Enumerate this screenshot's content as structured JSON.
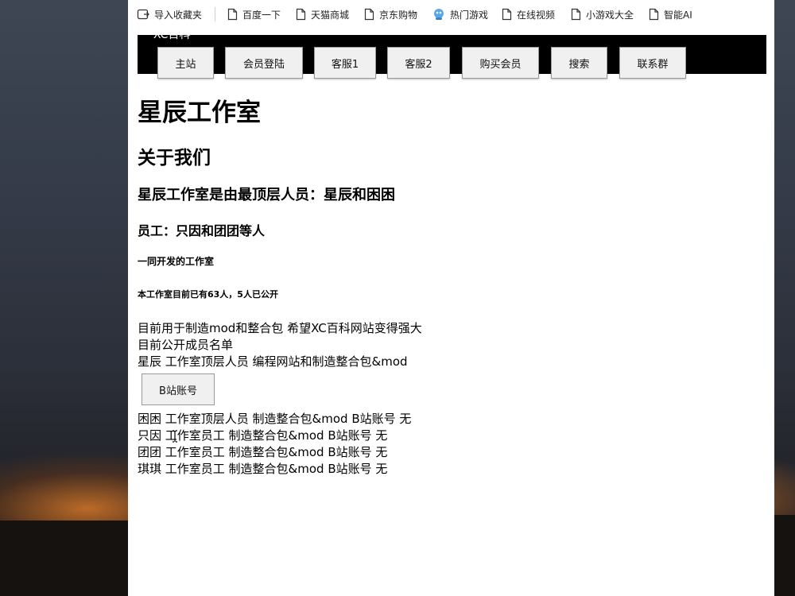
{
  "bookmarks": [
    {
      "label": "导入收藏夹",
      "icon": "import-bookmarks-icon"
    },
    {
      "label": "百度一下",
      "icon": "page-icon"
    },
    {
      "label": "天猫商城",
      "icon": "page-icon"
    },
    {
      "label": "京东购物",
      "icon": "page-icon"
    },
    {
      "label": "热门游戏",
      "icon": "game-mascot-icon"
    },
    {
      "label": "在线视频",
      "icon": "page-icon"
    },
    {
      "label": "小游戏大全",
      "icon": "page-icon"
    },
    {
      "label": "智能AI",
      "icon": "page-icon"
    }
  ],
  "site": {
    "brand": "XC百科",
    "nav": [
      "主站",
      "会员登陆",
      "客服1",
      "客服2",
      "购买会员",
      "搜索",
      "联系群"
    ]
  },
  "main": {
    "h1": "星辰工作室",
    "h2": "关于我们",
    "h3": "星辰工作室是由最顶层人员：星辰和困困",
    "h4": "员工：只因和团团等人",
    "h5": "一同开发的工作室",
    "h6": "本工作室目前已有63人，5人已公开",
    "p1": "目前用于制造mod和整合包 希望XC百科网站变得强大",
    "p2": "目前公开成员名单",
    "members": [
      "星辰 工作室顶层人员 编程网站和制造整合包&mod",
      "困困 工作室顶层人员 制造整合包&mod B站账号 无",
      "只因 工作室员工 制造整合包&mod B站账号 无",
      "团团 工作室员工 制造整合包&mod B站账号 无",
      "琪琪 工作室员工 制造整合包&mod B站账号 无"
    ],
    "bili_button": "B站账号"
  }
}
